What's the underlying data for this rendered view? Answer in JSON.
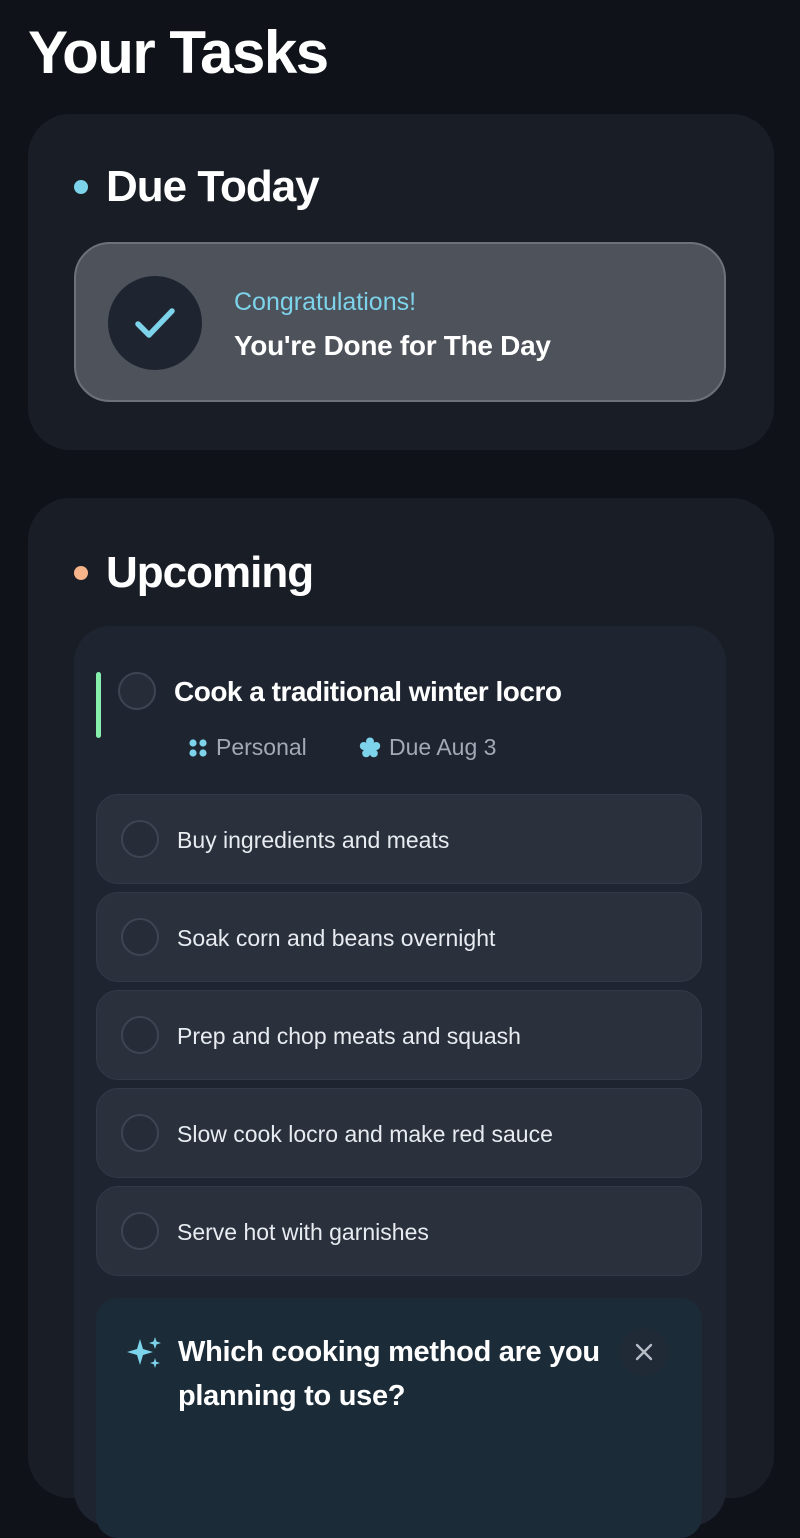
{
  "page": {
    "title": "Your Tasks"
  },
  "due_today": {
    "title": "Due Today",
    "dot_color": "#7dd3ea",
    "done_card": {
      "icon": "check-icon",
      "title": "Congratulations!",
      "subtitle": "You're Done for The Day"
    }
  },
  "upcoming": {
    "title": "Upcoming",
    "dot_color": "#f5b48a",
    "task": {
      "title": "Cook a traditional winter locro",
      "accent_color": "#86efac",
      "category": {
        "icon": "category-grid-icon",
        "label": "Personal"
      },
      "due": {
        "icon": "flower-badge-icon",
        "label": "Due Aug 3"
      },
      "subtasks": [
        {
          "label": "Buy ingredients and meats",
          "done": false
        },
        {
          "label": "Soak corn and beans overnight",
          "done": false
        },
        {
          "label": "Prep and chop meats and squash",
          "done": false
        },
        {
          "label": "Slow cook locro and make red sauce",
          "done": false
        },
        {
          "label": "Serve hot with garnishes",
          "done": false
        }
      ],
      "ai_prompt": {
        "icon": "sparkle-icon",
        "question": "Which cooking method are you planning to use?",
        "close_icon": "close-icon"
      }
    }
  }
}
